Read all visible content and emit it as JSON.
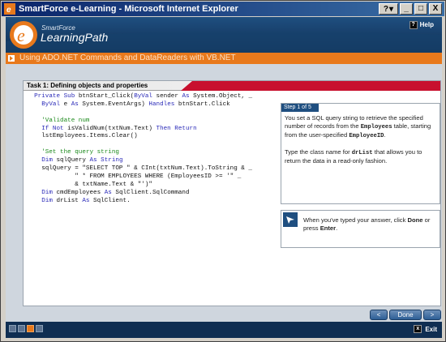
{
  "window": {
    "title": "SmartForce e-Learning - Microsoft Internet Explorer",
    "min": "_",
    "max": "□",
    "close": "X"
  },
  "header": {
    "brand_small": "SmartForce",
    "brand_big": "LearningPath",
    "help_label": "Help",
    "help_glyph": "?"
  },
  "module": {
    "title": "Using ADO.NET Commands and DataReaders with VB.NET"
  },
  "task": {
    "title": "Task 1: Defining objects and properties"
  },
  "code": [
    [
      {
        "t": "  "
      },
      {
        "t": "Private Sub",
        "k": "kw"
      },
      {
        "t": " btnStart_Click("
      },
      {
        "t": "ByVal",
        "k": "kw"
      },
      {
        "t": " sender "
      },
      {
        "t": "As",
        "k": "kw"
      },
      {
        "t": " System.Object, _"
      }
    ],
    [
      {
        "t": "    "
      },
      {
        "t": "ByVal",
        "k": "kw"
      },
      {
        "t": " e "
      },
      {
        "t": "As",
        "k": "kw"
      },
      {
        "t": " System.EventArgs) "
      },
      {
        "t": "Handles",
        "k": "kw"
      },
      {
        "t": " btnStart.Click"
      }
    ],
    [
      {
        "t": ""
      }
    ],
    [
      {
        "t": "    "
      },
      {
        "t": "'Validate num",
        "k": "cm"
      }
    ],
    [
      {
        "t": "    "
      },
      {
        "t": "If Not",
        "k": "kw"
      },
      {
        "t": " isValidNum(txtNum.Text) "
      },
      {
        "t": "Then Return",
        "k": "kw"
      }
    ],
    [
      {
        "t": "    lstEmployees.Items.Clear()"
      }
    ],
    [
      {
        "t": ""
      }
    ],
    [
      {
        "t": "    "
      },
      {
        "t": "'Set the query string",
        "k": "cm"
      }
    ],
    [
      {
        "t": "    "
      },
      {
        "t": "Dim",
        "k": "kw"
      },
      {
        "t": " sqlQuery "
      },
      {
        "t": "As String",
        "k": "kw"
      }
    ],
    [
      {
        "t": "    sqlQuery = \"SELECT TOP \" & CInt(txtNum.Text).ToString & _"
      }
    ],
    [
      {
        "t": "             \" * FROM EMPLOYEES WHERE (EmployeesID >= '\" _"
      }
    ],
    [
      {
        "t": "             & txtName.Text & \"')\""
      }
    ],
    [
      {
        "t": "    "
      },
      {
        "t": "Dim",
        "k": "kw"
      },
      {
        "t": " cmdEmployees "
      },
      {
        "t": "As",
        "k": "kw"
      },
      {
        "t": " SqlClient.SqlCommand"
      }
    ],
    [
      {
        "t": "    "
      },
      {
        "t": "Dim",
        "k": "kw"
      },
      {
        "t": " drList "
      },
      {
        "t": "As",
        "k": "kw"
      },
      {
        "t": " SqlClient."
      }
    ]
  ],
  "step": {
    "label": "Step 1 of 5",
    "text_a": "You set a SQL query string to retrieve the specified number of records from the ",
    "mono_a": "Employees",
    "text_b": " table, starting from the user-specified ",
    "mono_b": "EmployeeID",
    "text_c": ".",
    "text_d": "Type the class name for ",
    "mono_c": "drList",
    "text_e": " that allows you to return the data in a read-only fashion."
  },
  "hint": {
    "text_a": "When you've typed your answer, click ",
    "bold_a": "Done",
    "text_b": " or press ",
    "bold_b": "Enter",
    "text_c": "."
  },
  "nav": {
    "back": "<",
    "done": "Done",
    "next": ">"
  },
  "footer": {
    "exit_label": "Exit",
    "exit_glyph": "x"
  },
  "colors": {
    "navy": "#0f2e52",
    "orange": "#e8791c",
    "keyword": "#2a2ab8",
    "comment": "#1c8a1c",
    "red": "#c8102e"
  }
}
